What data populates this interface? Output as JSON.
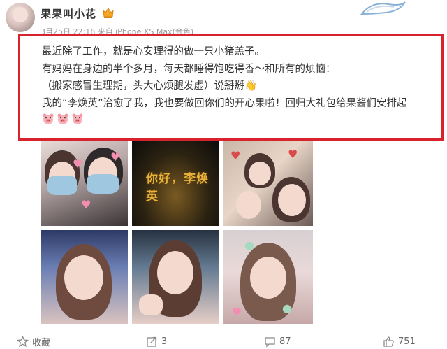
{
  "header": {
    "username": "果果叫小花",
    "meta": "3月25日 22:16 来自 iPhone XS Max(金色)"
  },
  "post": {
    "lines": [
      "最近除了工作，就是心安理得的做一只小猪羔子。",
      "有妈妈在身边的半个多月，每天都睡得饱吃得香～和所有的烦恼：",
      "（搬家感冒生理期，头大心烦腿发虚）说掰掰👋",
      "我的“李焕英”治愈了我，我也要做回你们的开心果啦！回归大礼包给果酱们安排起"
    ],
    "emoji_count": 3
  },
  "photos": {
    "p2_caption": "你好，李焕英"
  },
  "actions": {
    "favorite": "收藏",
    "share": "3",
    "comment": "87",
    "like": "751"
  },
  "colors": {
    "highlight": "#d8232f",
    "vip": "#f5a623",
    "text": "#333333"
  },
  "icons": {
    "favorite": "star-icon",
    "share": "share-icon",
    "comment": "comment-icon",
    "like": "thumbs-up-icon"
  }
}
